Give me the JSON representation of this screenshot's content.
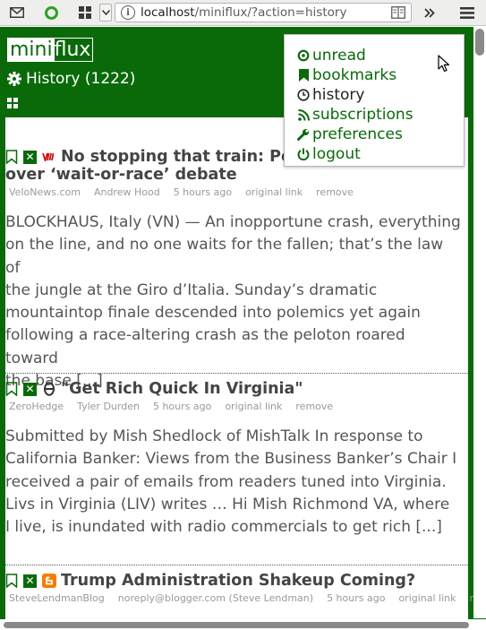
{
  "browser": {
    "url_host": "localhost",
    "url_path": "/miniflux/?action=history"
  },
  "app": {
    "logo_part1": "mini",
    "logo_part2": "flux",
    "page_title": "History (1222)"
  },
  "menu": {
    "items": [
      {
        "label": "unread",
        "icon": "gear-icon"
      },
      {
        "label": "bookmarks",
        "icon": "bookmark-icon"
      },
      {
        "label": "history",
        "icon": "clock-icon"
      },
      {
        "label": "subscriptions",
        "icon": "rss-icon"
      },
      {
        "label": "preferences",
        "icon": "wrench-icon"
      },
      {
        "label": "logout",
        "icon": "power-icon"
      }
    ],
    "active": "history"
  },
  "articles": [
    {
      "title_line1": "No stopping that train: Pe",
      "title_line2": "over ‘wait-or-race’ debate",
      "source": "VeloNews.com",
      "author": "Andrew Hood",
      "time": "5 hours ago",
      "link_label": "original link",
      "remove_label": "remove",
      "lines": [
        "BLOCKHAUS, Italy (VN) — An inopportune crash, everything",
        "on the line, and no one waits for the fallen; that’s the law of",
        "the jungle at the Giro d’Italia. Sunday’s dramatic",
        "mountaintop finale descended into polemics yet again",
        "following a race-altering crash as the peloton roared toward",
        "the base [...]"
      ]
    },
    {
      "title_line1": "\"Get Rich Quick In Virginia\"",
      "source": "ZeroHedge",
      "author": "Tyler Durden",
      "time": "5 hours ago",
      "link_label": "original link",
      "remove_label": "remove",
      "lines": [
        "Submitted by Mish Shedlock of MishTalk In response to",
        "California Banker: Views from the Business Banker’s Chair I",
        "received a pair of emails from readers tuned into Virginia.",
        "Livs in Virginia (LIV) writes … Hi Mish Richmond VA, where",
        "I live, is inundated with radio commercials to get rich [...]"
      ]
    },
    {
      "title_line1": "Trump Administration Shakeup Coming?",
      "source": "SteveLendmanBlog",
      "author": "noreply@blogger.com (Steve Lendman)",
      "time": "5 hours ago",
      "link_label": "original link",
      "remove_label": "remove"
    }
  ]
}
